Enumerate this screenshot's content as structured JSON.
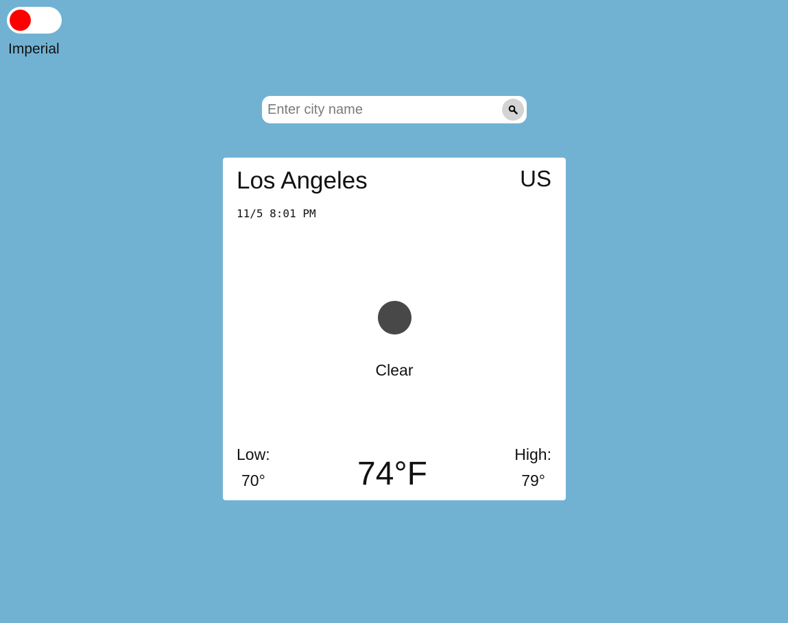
{
  "unit_toggle": {
    "label": "Imperial",
    "knob_color": "#ff0000"
  },
  "search": {
    "placeholder": "Enter city name",
    "value": "",
    "button_icon": "search-icon"
  },
  "weather": {
    "city": "Los Angeles",
    "country": "US",
    "datetime": "11/5 8:01 PM",
    "icon": "clear-weather-icon",
    "condition": "Clear",
    "low_label": "Low:",
    "low_value": "70°",
    "current_temp": "74°F",
    "high_label": "High:",
    "high_value": "79°"
  },
  "colors": {
    "background": "#71b2d3",
    "card": "#ffffff",
    "icon": "#484848"
  }
}
